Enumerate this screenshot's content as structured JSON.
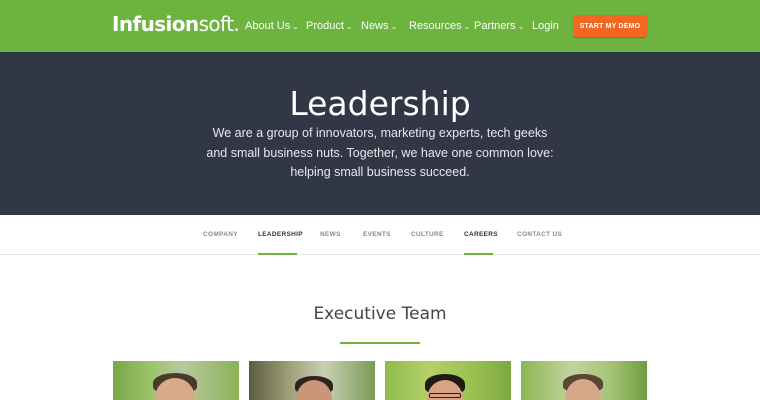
{
  "header": {
    "logo": {
      "bold": "Infusion",
      "light": "soft."
    },
    "nav": [
      {
        "label": "About Us",
        "chevron": true
      },
      {
        "label": "Product",
        "chevron": true
      },
      {
        "label": "News",
        "chevron": true
      },
      {
        "label": "Resources",
        "chevron": true
      },
      {
        "label": "Partners",
        "chevron": true
      },
      {
        "label": "Login",
        "chevron": false
      }
    ],
    "cta_label": "START MY DEMO",
    "colors": {
      "brand_green": "#6db33f",
      "cta_orange": "#f26722"
    }
  },
  "hero": {
    "title": "Leadership",
    "lines": [
      "We are a group of innovators, marketing experts, tech geeks",
      "and small business nuts. Together, we have one common love:",
      "helping small business succeed."
    ],
    "background": "#323746"
  },
  "subnav": {
    "items": [
      {
        "label": "COMPANY",
        "active": false
      },
      {
        "label": "LEADERSHIP",
        "active": true
      },
      {
        "label": "NEWS",
        "active": false
      },
      {
        "label": "EVENTS",
        "active": false
      },
      {
        "label": "CULTURE",
        "active": false
      },
      {
        "label": "CAREERS",
        "active": true
      },
      {
        "label": "CONTACT US",
        "active": false
      }
    ]
  },
  "section": {
    "title": "Executive Team"
  }
}
